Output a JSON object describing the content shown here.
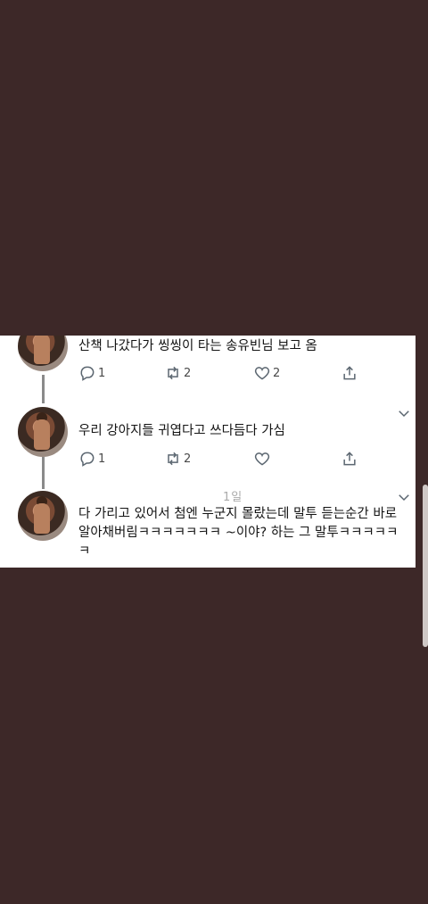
{
  "tweets": [
    {
      "meta": "",
      "text": "산책 나갔다가 씽씽이 타는 송유빈님 보고 옴",
      "reply_count": "1",
      "retweet_count": "2",
      "like_count": "2"
    },
    {
      "meta": "",
      "text": "우리 강아지들 귀엽다고 쓰다듬다 가심",
      "reply_count": "1",
      "retweet_count": "2",
      "like_count": ""
    },
    {
      "meta": "1일",
      "text": "다 가리고 있어서 첨엔 누군지 몰랐는데 말투 듣는순간 바로 알아채버림ㅋㅋㅋㅋㅋㅋㅋ ~이야? 하는 그 말투ㅋㅋㅋㅋㅋㅋ"
    }
  ],
  "icons": {
    "reply": "reply-icon",
    "retweet": "retweet-icon",
    "like": "heart-icon",
    "share": "share-icon",
    "more": "chevron-down-icon"
  },
  "colors": {
    "background": "#3d2828",
    "panel": "#ffffff",
    "text": "#141414",
    "icon": "#5b6670",
    "thread_line": "#8a8a8a"
  }
}
